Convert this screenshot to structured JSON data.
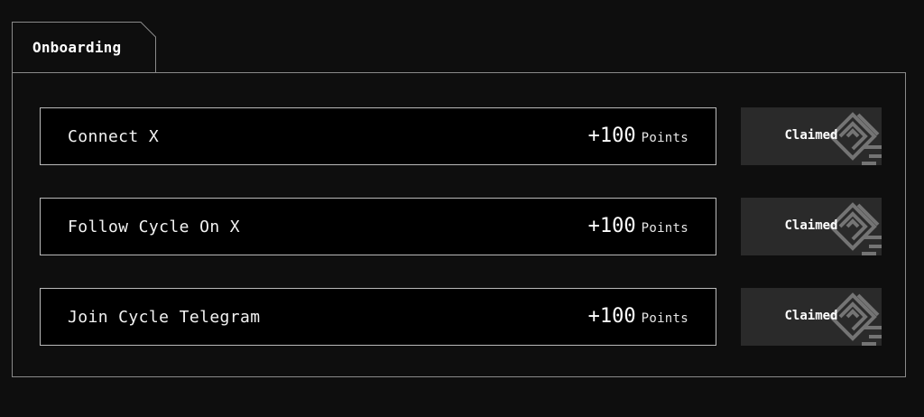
{
  "section": {
    "tab_label": "Onboarding"
  },
  "tasks": [
    {
      "title": "Connect X",
      "reward_amount": "+100",
      "reward_unit": "Points",
      "status_label": "Claimed"
    },
    {
      "title": "Follow Cycle On X",
      "reward_amount": "+100",
      "reward_unit": "Points",
      "status_label": "Claimed"
    },
    {
      "title": "Join Cycle Telegram",
      "reward_amount": "+100",
      "reward_unit": "Points",
      "status_label": "Claimed"
    }
  ],
  "colors": {
    "background": "#0e0e0e",
    "card": "#000000",
    "card_border": "#b9b9b9",
    "panel_border": "#8a8a8a",
    "button": "#2a2a2a",
    "text": "#ffffff"
  },
  "icons": {
    "claim_pattern": "maze-pattern-icon"
  }
}
